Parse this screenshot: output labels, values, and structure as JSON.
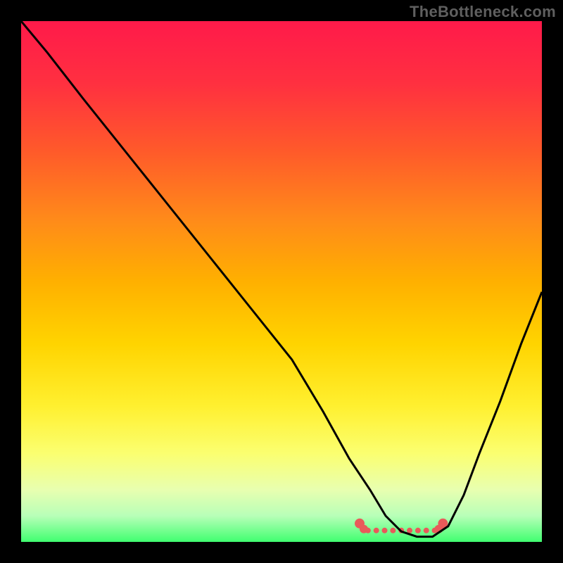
{
  "attribution": "TheBottleneck.com",
  "chart_data": {
    "type": "line",
    "title": "",
    "xlabel": "",
    "ylabel": "",
    "xlim": [
      0,
      100
    ],
    "ylim": [
      0,
      100
    ],
    "x": [
      0,
      5,
      12,
      20,
      28,
      36,
      44,
      52,
      58,
      63,
      67,
      70,
      73,
      76,
      79,
      82,
      85,
      88,
      92,
      96,
      100
    ],
    "values": [
      100,
      94,
      85,
      75,
      65,
      55,
      45,
      35,
      25,
      16,
      10,
      5,
      2,
      1,
      1,
      3,
      9,
      17,
      27,
      38,
      48
    ],
    "optimal_marker": {
      "left_x": 65,
      "right_x": 81,
      "y": 3
    },
    "gradient_stops": [
      {
        "offset": 0.0,
        "color": "#ff1a4a"
      },
      {
        "offset": 0.12,
        "color": "#ff3040"
      },
      {
        "offset": 0.25,
        "color": "#ff5a2a"
      },
      {
        "offset": 0.38,
        "color": "#ff8a1a"
      },
      {
        "offset": 0.5,
        "color": "#ffb000"
      },
      {
        "offset": 0.62,
        "color": "#ffd400"
      },
      {
        "offset": 0.74,
        "color": "#fff030"
      },
      {
        "offset": 0.83,
        "color": "#fbff70"
      },
      {
        "offset": 0.9,
        "color": "#e8ffb0"
      },
      {
        "offset": 0.95,
        "color": "#b8ffb8"
      },
      {
        "offset": 1.0,
        "color": "#40ff70"
      }
    ],
    "colors": {
      "curve": "#000000",
      "marker_fill": "#f07070",
      "marker_dot": "#e85a5a"
    }
  }
}
